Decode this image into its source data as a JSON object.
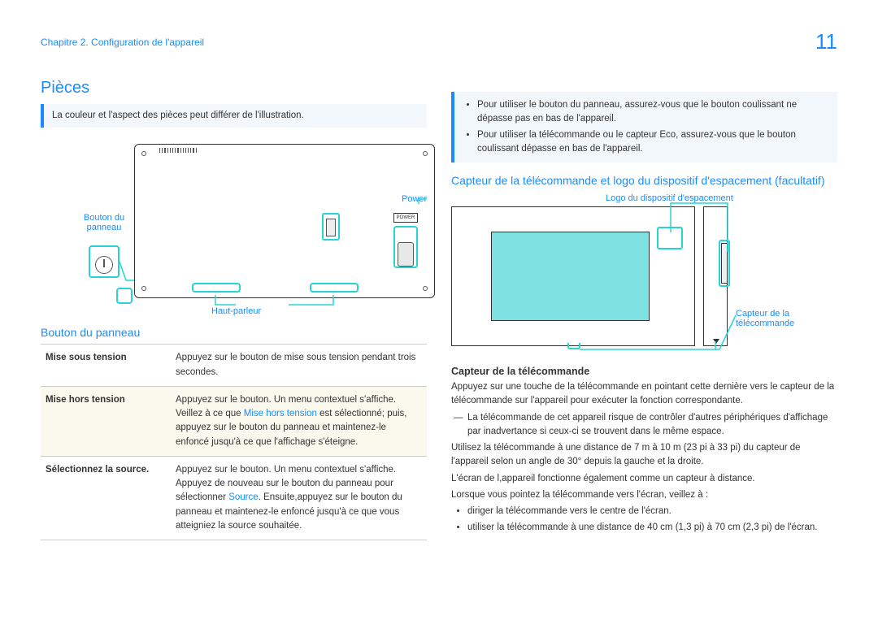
{
  "header": {
    "chapter": "Chapitre 2. Configuration de l'appareil",
    "page_number": "11"
  },
  "left": {
    "title": "Pièces",
    "note": "La couleur et l'aspect des pièces peut différer de l'illustration.",
    "fig_labels": {
      "panel_button": "Bouton du\npanneau",
      "speaker": "Haut-parleur",
      "power": "Power",
      "power_badge": "POWER"
    },
    "sub_title": "Bouton du panneau",
    "table": {
      "rows": [
        {
          "label": "Mise sous tension",
          "desc": "Appuyez sur le bouton de mise sous tension pendant trois secondes."
        },
        {
          "label": "Mise hors tension",
          "desc_pre": "Appuyez sur le bouton. Un menu contextuel s'affiche.",
          "desc_mid_before": "Veillez à ce que ",
          "desc_mid_hl": "Mise hors tension",
          "desc_mid_after": " est sélectionné; puis, appuyez sur le bouton du panneau et maintenez-le enfoncé jusqu'à ce que l'affichage s'éteigne."
        },
        {
          "label": "Sélectionnez la source.",
          "desc_pre": "Appuyez sur le bouton. Un menu contextuel s'affiche.",
          "desc_mid_before": "Appuyez de nouveau sur le bouton du panneau pour sélectionner ",
          "desc_mid_hl": "Source",
          "desc_mid_after": ". Ensuite,appuyez sur le bouton du panneau et maintenez-le enfoncé jusqu'à ce que vous atteigniez la source souhaitée."
        }
      ]
    }
  },
  "right": {
    "info_items": [
      "Pour utiliser le bouton du panneau, assurez-vous que le bouton coulissant ne dépasse pas en bas de l'appareil.",
      "Pour utiliser la télécommande ou le capteur Eco, assurez-vous que le bouton coulissant dépasse en bas de l'appareil."
    ],
    "sub_title": "Capteur de la télécommande et logo du dispositif d'espacement (facultatif)",
    "fig_labels": {
      "spacing_logo": "Logo du dispositif d'espacement",
      "remote_sensor": "Capteur de la télécommande"
    },
    "sensor_heading": "Capteur de la télécommande",
    "para1": "Appuyez sur une touche de la télécommande en pointant cette dernière vers le capteur de la télécommande sur l'appareil pour exécuter la fonction correspondante.",
    "dash_note": "La télécommande de cet appareil risque de contrôler d'autres périphériques d'affichage par inadvertance si ceux-ci se trouvent dans le même espace.",
    "para2": "Utilisez la télécommande à une distance de 7 m à 10 m (23 pi à 33 pi) du capteur de l'appareil selon un angle de 30° depuis la gauche et la droite.",
    "para3": "L'écran de l,appareil fonctionne également comme un capteur à distance.",
    "para4": "Lorsque vous pointez la télécommande vers l'écran, veillez à :",
    "bullets": [
      "diriger la télécommande vers le centre de l'écran.",
      "utiliser la télécommande à une distance de 40 cm (1,3 pi) à  70 cm (2,3 pi) de l'écran."
    ]
  }
}
